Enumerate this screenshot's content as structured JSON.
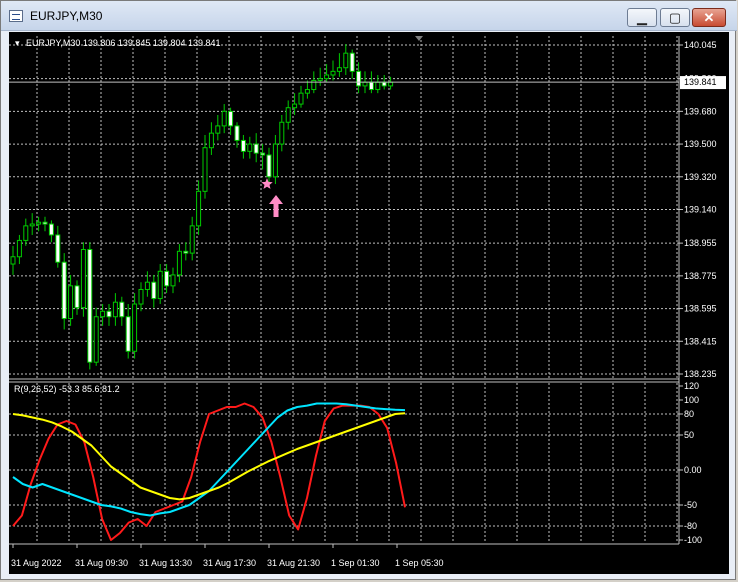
{
  "window": {
    "title": "EURJPY,M30",
    "icon": "chart-window-icon",
    "buttons": {
      "minimize": "minimize-icon",
      "maximize": "maximize-icon",
      "close": "close-icon"
    }
  },
  "main_panel": {
    "info_prefix": "▾",
    "info": "EURJPY,M30  139.806 139.845 139.804 139.841",
    "price_ticks": [
      "140.045",
      "139.860",
      "139.680",
      "139.500",
      "139.320",
      "139.140",
      "138.955",
      "138.775",
      "138.595",
      "138.415",
      "138.235"
    ],
    "current_price": "139.841",
    "colors": {
      "bull": "#00cc00",
      "bear_fill": "#ffffff",
      "bull_fill": "#000000",
      "grid": "#c0c0c0",
      "marker": "#ff8cc6"
    }
  },
  "indicator_panel": {
    "info": "R(9,26,52) -53.3 85.6 81.2",
    "ticks": [
      "120",
      "100",
      "80",
      "50",
      "0.00",
      "-50",
      "-80",
      "-100"
    ],
    "colors": {
      "fast": "#ff1a1a",
      "medium": "#00e5ff",
      "slow": "#ffff00"
    }
  },
  "time_labels": [
    "31 Aug 2022",
    "31 Aug 09:30",
    "31 Aug 13:30",
    "31 Aug 17:30",
    "31 Aug 21:30",
    "1 Sep 01:30",
    "1 Sep 05:30"
  ],
  "chart_data": [
    {
      "type": "candlestick",
      "title": "EURJPY,M30",
      "ylim": [
        138.235,
        140.045
      ],
      "open": [
        138.84,
        138.88,
        138.97,
        139.05,
        139.06,
        139.07,
        139.06,
        139.0,
        138.85,
        138.54,
        138.72,
        138.6,
        138.92,
        138.3,
        138.55,
        138.58,
        138.55,
        138.63,
        138.55,
        138.36,
        138.62,
        138.7,
        138.74,
        138.65,
        138.8,
        138.72,
        138.78,
        138.91,
        138.9,
        139.05,
        139.24,
        139.48,
        139.56,
        139.6,
        139.68,
        139.6,
        139.52,
        139.46,
        139.5,
        139.45,
        139.44,
        139.32,
        139.5,
        139.62,
        139.7,
        139.72,
        139.78,
        139.8,
        139.85,
        139.86,
        139.88,
        139.9,
        139.92,
        140.0,
        139.9,
        139.82,
        139.84,
        139.8,
        139.84,
        139.82
      ],
      "close": [
        138.88,
        138.97,
        139.05,
        139.06,
        139.07,
        139.06,
        139.0,
        138.85,
        138.54,
        138.72,
        138.6,
        138.92,
        138.3,
        138.55,
        138.58,
        138.55,
        138.63,
        138.55,
        138.36,
        138.62,
        138.7,
        138.74,
        138.65,
        138.8,
        138.72,
        138.78,
        138.91,
        138.9,
        139.05,
        139.24,
        139.48,
        139.56,
        139.6,
        139.68,
        139.6,
        139.52,
        139.46,
        139.5,
        139.45,
        139.44,
        139.32,
        139.5,
        139.62,
        139.7,
        139.72,
        139.78,
        139.8,
        139.85,
        139.86,
        139.88,
        139.9,
        139.92,
        140.0,
        139.9,
        139.82,
        139.84,
        139.8,
        139.84,
        139.82,
        139.84
      ],
      "high": [
        138.94,
        139.0,
        139.09,
        139.12,
        139.1,
        139.1,
        139.08,
        139.05,
        138.9,
        138.78,
        138.75,
        138.96,
        138.96,
        138.6,
        138.62,
        138.62,
        138.68,
        138.66,
        138.62,
        138.68,
        138.74,
        138.8,
        138.78,
        138.84,
        138.84,
        138.82,
        138.95,
        138.96,
        139.1,
        139.3,
        139.55,
        139.62,
        139.66,
        139.72,
        139.7,
        139.62,
        139.55,
        139.54,
        139.56,
        139.5,
        139.48,
        139.55,
        139.66,
        139.74,
        139.78,
        139.82,
        139.85,
        139.9,
        139.92,
        139.94,
        139.96,
        140.0,
        140.05,
        140.02,
        139.95,
        139.9,
        139.9,
        139.88,
        139.88,
        139.87
      ],
      "low": [
        138.78,
        138.84,
        138.94,
        139.0,
        139.02,
        139.02,
        138.96,
        138.82,
        138.48,
        138.5,
        138.56,
        138.55,
        138.26,
        138.28,
        138.5,
        138.5,
        138.5,
        138.5,
        138.32,
        138.32,
        138.58,
        138.66,
        138.6,
        138.62,
        138.68,
        138.68,
        138.74,
        138.86,
        138.86,
        139.0,
        139.2,
        139.44,
        139.52,
        139.56,
        139.55,
        139.48,
        139.42,
        139.42,
        139.4,
        139.36,
        139.26,
        139.28,
        139.46,
        139.58,
        139.66,
        139.7,
        139.75,
        139.78,
        139.82,
        139.84,
        139.85,
        139.87,
        139.88,
        139.86,
        139.78,
        139.78,
        139.78,
        139.78,
        139.8,
        139.8
      ],
      "markers": [
        {
          "kind": "star",
          "price": 139.28
        },
        {
          "kind": "arrow-up",
          "price": 139.22
        }
      ],
      "current_price": 139.841
    },
    {
      "type": "line",
      "title": "R(9,26,52)",
      "ylim": [
        -110,
        120
      ],
      "series": [
        {
          "name": "R9",
          "color": "#ff1a1a",
          "values": [
            -80,
            -65,
            -20,
            15,
            45,
            65,
            70,
            65,
            40,
            -10,
            -70,
            -100,
            -90,
            -75,
            -70,
            -80,
            -60,
            -55,
            -50,
            -45,
            -10,
            40,
            80,
            85,
            90,
            90,
            95,
            90,
            75,
            40,
            -10,
            -65,
            -85,
            -40,
            20,
            70,
            88,
            92,
            92,
            92,
            90,
            80,
            60,
            10,
            -53.3
          ]
        },
        {
          "name": "R26",
          "color": "#00e5ff",
          "values": [
            -10,
            -20,
            -25,
            -20,
            -25,
            -30,
            -35,
            -40,
            -45,
            -50,
            -52,
            -55,
            -60,
            -63,
            -65,
            -62,
            -60,
            -55,
            -50,
            -40,
            -30,
            -15,
            0,
            15,
            30,
            45,
            60,
            75,
            85,
            90,
            92,
            95,
            95,
            95,
            94,
            92,
            90,
            88,
            87,
            86,
            85.6
          ]
        },
        {
          "name": "R52",
          "color": "#ffff00",
          "values": [
            80,
            78,
            75,
            72,
            68,
            62,
            55,
            45,
            35,
            20,
            5,
            -5,
            -15,
            -25,
            -30,
            -35,
            -40,
            -42,
            -40,
            -35,
            -30,
            -25,
            -18,
            -10,
            -2,
            5,
            12,
            18,
            24,
            30,
            35,
            40,
            45,
            50,
            55,
            60,
            65,
            70,
            75,
            80,
            81.2
          ]
        }
      ]
    }
  ]
}
